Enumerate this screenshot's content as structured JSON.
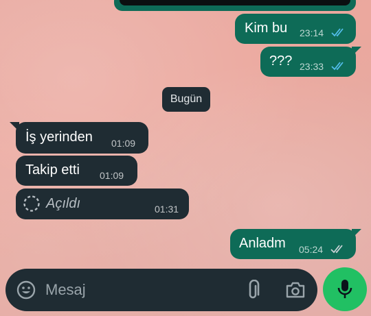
{
  "date_divider": "Bugün",
  "messages": [
    {
      "text": "Kim bu",
      "time": "23:14",
      "direction": "outgoing",
      "status": "read"
    },
    {
      "text": "???",
      "time": "23:33",
      "direction": "outgoing",
      "status": "read"
    },
    {
      "text": "İş yerinden",
      "time": "01:09",
      "direction": "incoming"
    },
    {
      "text": "Takip etti",
      "time": "01:09",
      "direction": "incoming"
    },
    {
      "text": "Açıldı",
      "time": "01:31",
      "direction": "incoming",
      "type": "view-once-opened"
    },
    {
      "text": "Anladm",
      "time": "05:24",
      "direction": "outgoing",
      "status": "delivered"
    }
  ],
  "composer": {
    "placeholder": "Mesaj",
    "icons": [
      "emoji-icon",
      "attach-icon",
      "camera-icon",
      "mic-icon"
    ]
  },
  "colors": {
    "outgoing_bubble": "#0e6b57",
    "incoming_bubble": "#1f2c33",
    "read_tick": "#53bdeb",
    "mic_button": "#21c063",
    "wallpaper": "#e9a9a0"
  }
}
